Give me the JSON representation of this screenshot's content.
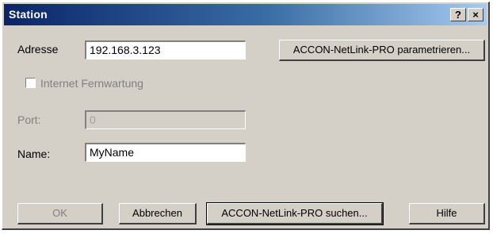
{
  "window": {
    "title": "Station",
    "help_glyph": "?",
    "close_glyph": "×"
  },
  "form": {
    "address_label": "Adresse",
    "address_value": "192.168.3.123",
    "remote_label": "Internet Fernwartung",
    "remote_checked": false,
    "port_label": "Port:",
    "port_value": "0",
    "name_label": "Name:",
    "name_value": "MyName"
  },
  "buttons": {
    "configure": "ACCON-NetLink-PRO parametrieren...",
    "ok": "OK",
    "cancel": "Abbrechen",
    "search": "ACCON-NetLink-PRO suchen...",
    "help": "Hilfe"
  }
}
